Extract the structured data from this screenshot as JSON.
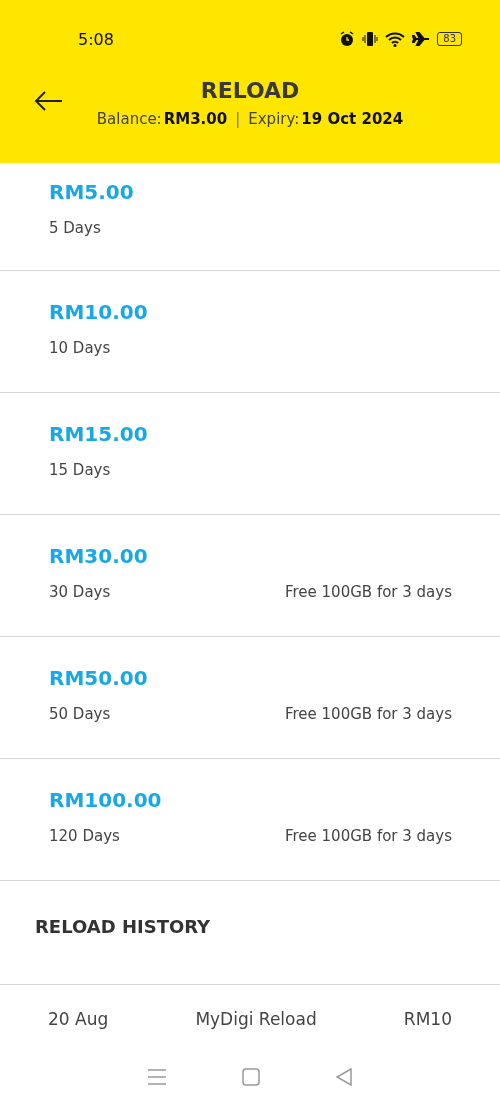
{
  "status_bar": {
    "time": "5:08",
    "battery": "83"
  },
  "header": {
    "title": "RELOAD",
    "balance_label": "Balance:",
    "balance": "RM3.00",
    "separator": "|",
    "expiry_label": "Expiry:",
    "expiry": "19 Oct 2024"
  },
  "plans": [
    {
      "price": "RM5.00",
      "validity": "5 Days"
    },
    {
      "price": "RM10.00",
      "validity": "10 Days"
    },
    {
      "price": "RM15.00",
      "validity": "15 Days"
    },
    {
      "price": "RM30.00",
      "validity": "30 Days",
      "bonus": "Free 100GB for 3 days"
    },
    {
      "price": "RM50.00",
      "validity": "50 Days",
      "bonus": "Free 100GB for 3 days"
    },
    {
      "price": "RM100.00",
      "validity": "120 Days",
      "bonus": "Free 100GB for 3 days"
    }
  ],
  "history": {
    "title": "RELOAD HISTORY",
    "rows": [
      {
        "date": "20 Aug",
        "description": "MyDigi Reload",
        "amount": "RM10"
      }
    ]
  }
}
